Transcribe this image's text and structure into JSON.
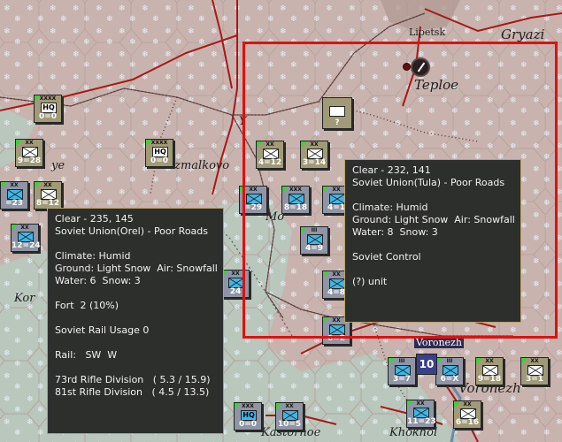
{
  "map": {
    "labels": {
      "lipetsk": "Lipetsk",
      "gryazi": "Gryazi",
      "teploe": "Teploe",
      "izmalkovo": "Izmalkovo",
      "voronezh": "Voronezh",
      "voronezh_city": "Voronezh",
      "kastornoe": "Kastornoe",
      "khokhol": "Khokhol",
      "frag_ye": "ye",
      "frag_y": "Y",
      "frag_kor": "Kor",
      "frag_mo": "Mo",
      "frag_rr": "R"
    },
    "stack_count": "10",
    "colors": {
      "terrain": "#c9b3ae",
      "frozen_marsh": "#b9c7bd",
      "selection": "#e01010",
      "rail": "#5a3a3a",
      "road": "#a81818"
    }
  },
  "units": [
    {
      "id": "hq1",
      "size": "XXXX",
      "label": "HQ",
      "str": "0=0",
      "side": "soviet"
    },
    {
      "id": "hq2",
      "size": "XXXX",
      "label": "HQ",
      "str": "0=0",
      "side": "soviet"
    },
    {
      "id": "u1",
      "size": "XX",
      "str": "9=28",
      "side": "soviet"
    },
    {
      "id": "u2",
      "size": "XX",
      "str": "4=12",
      "side": "soviet"
    },
    {
      "id": "u3",
      "size": "XX",
      "str": "3=14",
      "side": "soviet"
    },
    {
      "id": "u4",
      "size": "XX",
      "str": "8=12",
      "side": "soviet"
    },
    {
      "id": "u5",
      "size": "XX",
      "str": "=23",
      "side": "axis"
    },
    {
      "id": "u6",
      "size": "XX",
      "str": "12=24",
      "side": "axis"
    },
    {
      "id": "u7",
      "size": "XX",
      "str": "=29",
      "side": "axis"
    },
    {
      "id": "u8",
      "size": "XXX",
      "str": "8=18",
      "side": "axis"
    },
    {
      "id": "u9",
      "size": "III",
      "str": "4=9",
      "side": "axis"
    },
    {
      "id": "u10",
      "size": "XX",
      "str": "4=1",
      "side": "axis"
    },
    {
      "id": "u11",
      "size": "III",
      "str": "3=7",
      "side": "axis"
    },
    {
      "id": "u12",
      "size": "III",
      "str": "6=X",
      "side": "axis"
    },
    {
      "id": "u13",
      "size": "XX",
      "str": "9=18",
      "side": "soviet"
    },
    {
      "id": "u14",
      "size": "XX",
      "str": "3=1",
      "side": "soviet"
    },
    {
      "id": "u15",
      "size": "XXX",
      "label": "HQ",
      "str": "0=0",
      "side": "axis"
    },
    {
      "id": "u16",
      "size": "XX",
      "str": "10=5",
      "side": "axis"
    },
    {
      "id": "u17",
      "size": "XX",
      "str": "11=23",
      "side": "axis"
    },
    {
      "id": "u18",
      "size": "XX",
      "str": "6=16",
      "side": "soviet"
    },
    {
      "id": "u19",
      "size": "XX",
      "str": "24",
      "side": "axis"
    },
    {
      "id": "u20",
      "size": "XX",
      "str": "6=2",
      "side": "axis"
    },
    {
      "id": "u21",
      "size": "XX",
      "str": "4=8",
      "side": "axis"
    }
  ],
  "unknown_unit": {
    "mark": "?"
  },
  "tooltip_left": {
    "lines": [
      "Clear - 235, 145",
      "Soviet Union(Orel) - Poor Roads",
      "",
      "Climate: Humid",
      "Ground: Light Snow  Air: Snowfall",
      "Water: 6  Snow: 3",
      "",
      "Fort  2 (10%)",
      "",
      "Soviet Rail Usage 0",
      "",
      "Rail:   SW  W",
      "",
      "73rd Rifle Division   ( 5.3 / 15.9)",
      "81st Rifle Division   ( 4.5 / 13.5)"
    ]
  },
  "tooltip_right": {
    "lines": [
      "Clear - 232, 141",
      "Soviet Union(Tula) - Poor Roads",
      "",
      "Climate: Humid",
      "Ground: Light Snow  Air: Snowfall",
      "Water: 8  Snow: 3",
      "",
      "Soviet Control",
      "",
      "(?) unit"
    ]
  }
}
